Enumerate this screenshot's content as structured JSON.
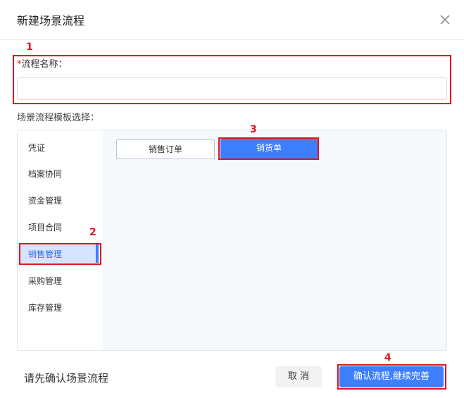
{
  "dialog": {
    "title": "新建场景流程"
  },
  "form": {
    "name_label": "流程名称：",
    "required_mark": "*",
    "name_value": "",
    "name_placeholder": "",
    "template_label": "场景流程模板选择："
  },
  "sidebar": {
    "items": [
      {
        "label": "凭证"
      },
      {
        "label": "档案协同"
      },
      {
        "label": "资金管理"
      },
      {
        "label": "项目合同"
      },
      {
        "label": "销售管理",
        "selected": true
      },
      {
        "label": "采购管理"
      },
      {
        "label": "库存管理"
      }
    ]
  },
  "templates": {
    "tabs": [
      {
        "label": "销售订单",
        "selected": false
      },
      {
        "label": "销货单",
        "selected": true
      }
    ]
  },
  "footer": {
    "hint": "请先确认场景流程",
    "cancel_label": "取 消",
    "confirm_label": "确认流程,继续完善"
  },
  "annotations": [
    "1",
    "2",
    "3",
    "4"
  ],
  "colors": {
    "accent": "#3d7fff",
    "annotation_red": "#e0141e",
    "selected_bg": "#d6e4ff",
    "panel_bg": "#f6f9fc"
  },
  "icons": {
    "close": "close-icon"
  }
}
